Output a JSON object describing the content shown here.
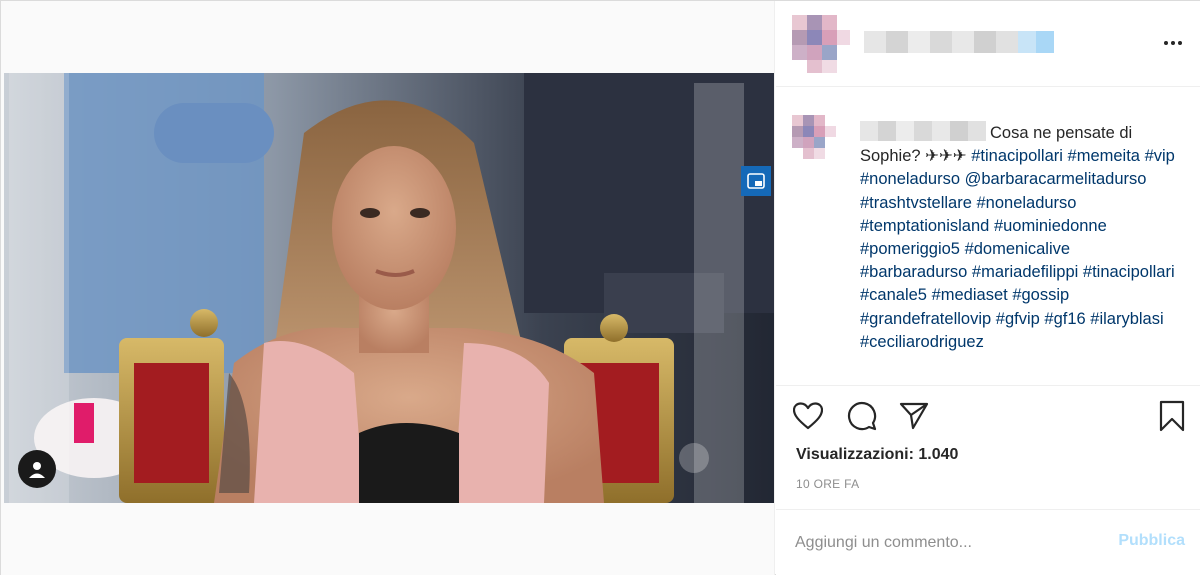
{
  "post": {
    "header": {
      "username_redacted": true,
      "more_icon": "more-horizontal-icon"
    },
    "caption": {
      "username_redacted": true,
      "text_before": "Cosa ne pensate di Sophie? ✈✈✈",
      "tags": [
        "#tinacipollari",
        "#memeita",
        "#vip",
        "#noneladurso",
        "@barbaracarmelitadurso",
        "#trashtvstellare",
        "#noneladurso",
        "#temptationisland",
        "#uominiedonne",
        "#pomeriggio5",
        "#domenicalive",
        "#barbaradurso",
        "#mariadefilippi",
        "#tinacipollari",
        "#canale5",
        "#mediaset",
        "#gossip",
        "#grandefratellovip",
        "#gfvip",
        "#gf16",
        "#ilaryblasi",
        "#ceciliarodriguez"
      ]
    },
    "actions": {
      "like_icon": "heart-icon",
      "comment_icon": "comment-icon",
      "share_icon": "paper-plane-icon",
      "save_icon": "bookmark-icon"
    },
    "stats": {
      "views": "Visualizzazioni: 1.040",
      "time": "10 ORE FA"
    },
    "comment": {
      "placeholder": "Aggiungi un commento...",
      "publish_label": "Pubblica"
    },
    "media": {
      "user_tag_icon": "user-icon",
      "pip_icon": "picture-in-picture-icon"
    },
    "colors": {
      "link": "#00376b",
      "publish_disabled": "#b2dffc",
      "muted": "#8e8e8e"
    }
  }
}
